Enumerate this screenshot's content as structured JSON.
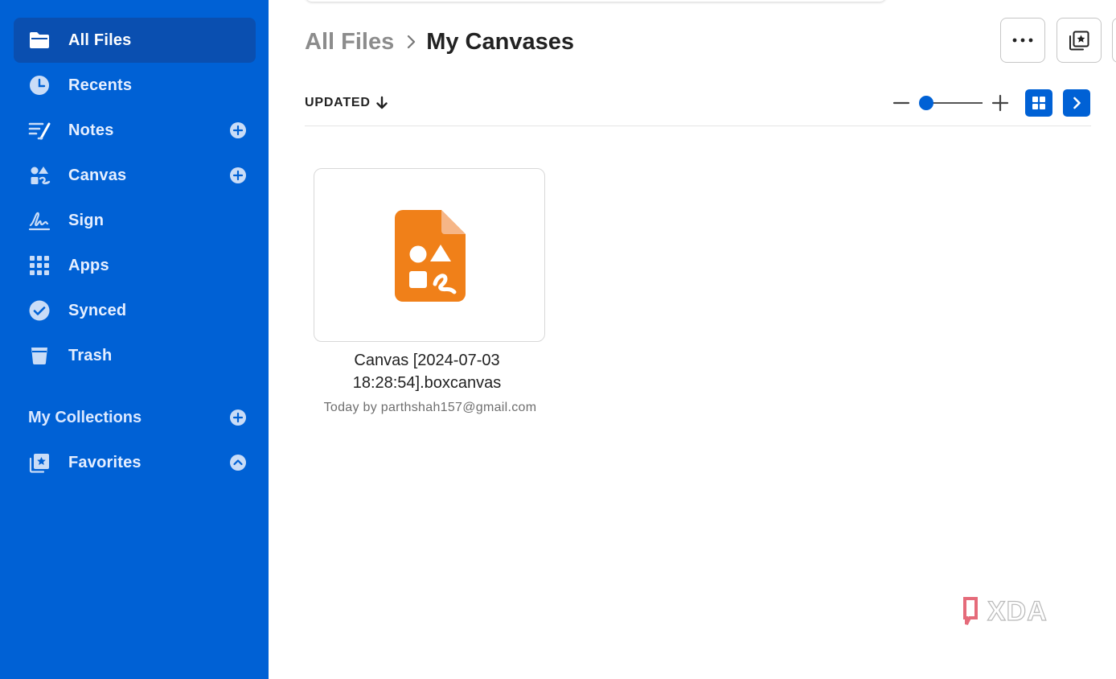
{
  "sidebar": {
    "items": [
      {
        "label": "All Files",
        "icon": "folder-icon",
        "active": true
      },
      {
        "label": "Recents",
        "icon": "clock-icon"
      },
      {
        "label": "Notes",
        "icon": "notes-icon",
        "has_add": true
      },
      {
        "label": "Canvas",
        "icon": "canvas-icon",
        "has_add": true
      },
      {
        "label": "Sign",
        "icon": "signature-icon"
      },
      {
        "label": "Apps",
        "icon": "apps-grid-icon"
      },
      {
        "label": "Synced",
        "icon": "check-circle-icon"
      },
      {
        "label": "Trash",
        "icon": "trash-icon"
      }
    ],
    "collections_label": "My Collections",
    "favorites_label": "Favorites"
  },
  "breadcrumb": {
    "root": "All Files",
    "current": "My Canvases"
  },
  "toolbar": {
    "sort_label": "UPDATED",
    "sort_direction": "descending"
  },
  "files": [
    {
      "name": "Canvas [2024-07-03 18:28:54].boxcanvas",
      "meta": "Today by parthshah157@gmail.com",
      "icon": "canvas-file-icon"
    }
  ],
  "watermark": "XDA",
  "colors": {
    "sidebar": "#0061d5",
    "sidebar_active": "#0a4fb0",
    "accent": "#0061d5",
    "canvas_orange": "#f08019"
  }
}
